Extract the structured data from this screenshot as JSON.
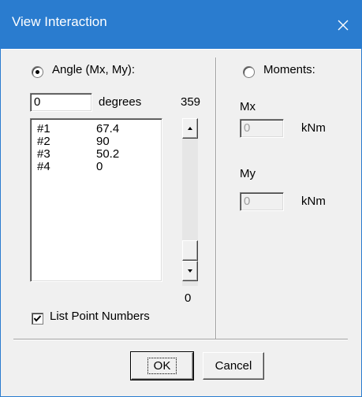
{
  "window": {
    "title": "View Interaction",
    "close_icon": "close-icon"
  },
  "angle": {
    "radio_label": "Angle (Mx, My):",
    "selected": true,
    "input_value": "0",
    "unit": "degrees",
    "scroll_max": "359",
    "scroll_min": "0"
  },
  "points": [
    {
      "num": "#1",
      "value": "67.4"
    },
    {
      "num": "#2",
      "value": "90"
    },
    {
      "num": "#3",
      "value": "50.2"
    },
    {
      "num": "#4",
      "value": "0"
    }
  ],
  "list_point_numbers": {
    "label": "List Point Numbers",
    "checked": true
  },
  "moments": {
    "radio_label": "Moments:",
    "selected": false,
    "mx_label": "Mx",
    "mx_value": "0",
    "mx_unit": "kNm",
    "my_label": "My",
    "my_value": "0",
    "my_unit": "kNm"
  },
  "buttons": {
    "ok": "OK",
    "cancel": "Cancel"
  },
  "colors": {
    "titlebar": "#2a7ccf",
    "dialog_bg": "#f0f0f0"
  }
}
